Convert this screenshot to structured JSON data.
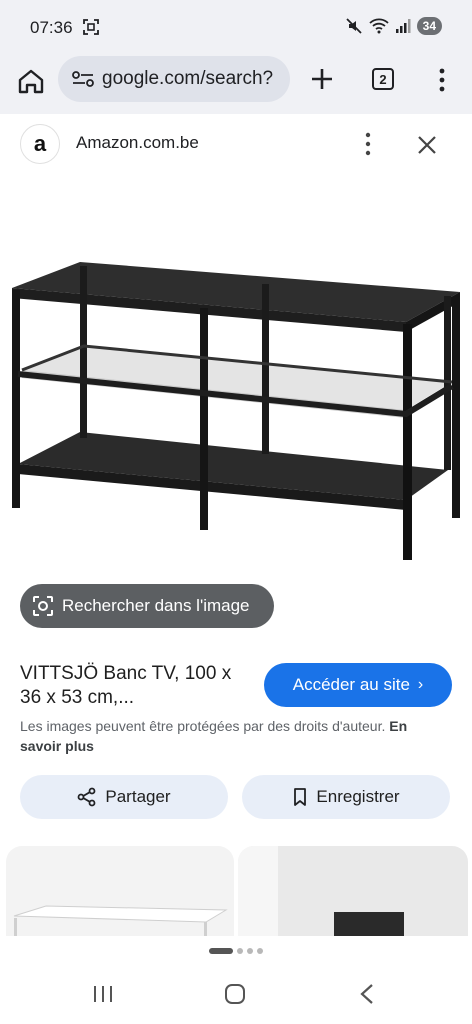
{
  "status_bar": {
    "time": "07:36",
    "battery": "34"
  },
  "browser": {
    "url": "google.com/search?",
    "tab_count": "2"
  },
  "sheet": {
    "source_name": "Amazon.com.be",
    "source_logo_letter": "a",
    "lens_label": "Rechercher dans l'image",
    "title": "VITTSJÖ Banc TV, 100 x 36 x 53 cm,...",
    "visit_label": "Accéder au site",
    "copyright_text": "Les images peuvent être protégées par des droits d'auteur.",
    "learn_more": "En savoir plus",
    "share_label": "Partager",
    "save_label": "Enregistrer"
  },
  "colors": {
    "accent": "#1a73e8",
    "chip": "#5c5f62",
    "action_bg": "#e8eef8"
  },
  "pager": {
    "current": 1,
    "total": 4
  }
}
